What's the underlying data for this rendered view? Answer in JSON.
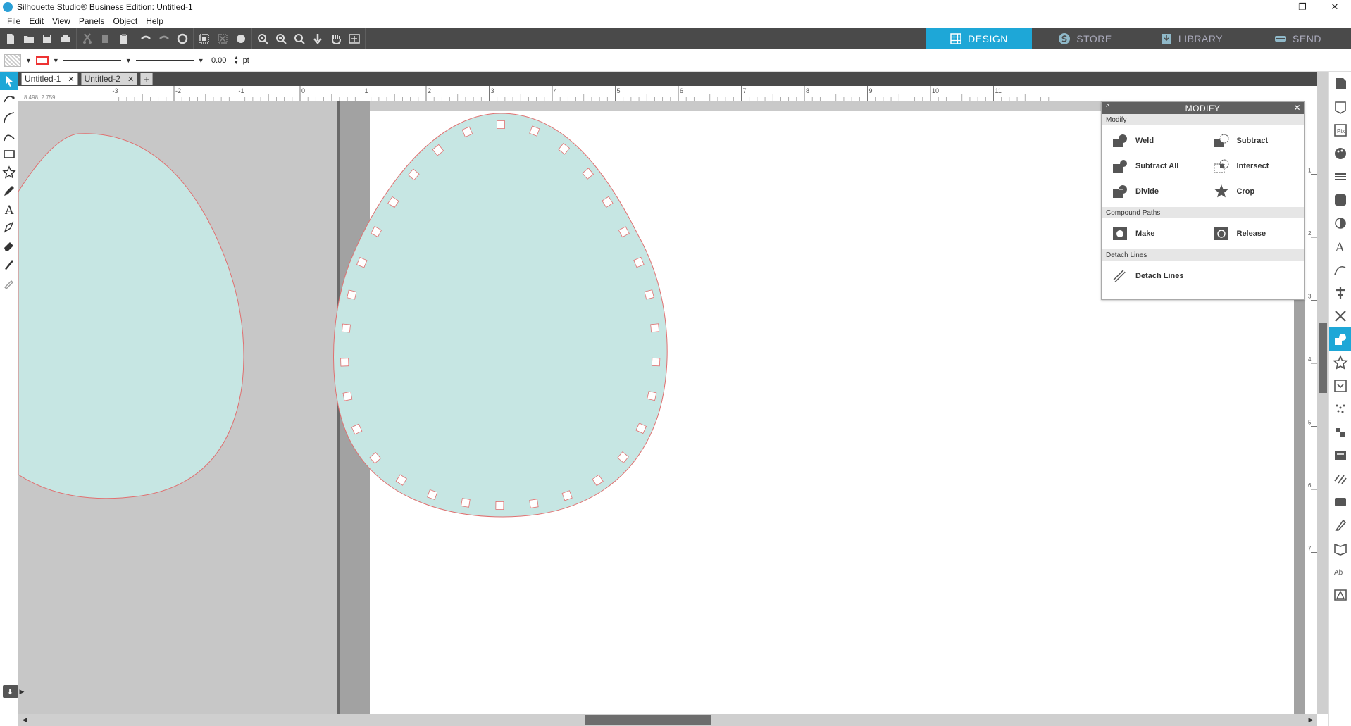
{
  "window": {
    "title": "Silhouette Studio® Business Edition: Untitled-1",
    "minimize": "–",
    "restore": "❐",
    "close": "✕"
  },
  "menu": [
    "File",
    "Edit",
    "View",
    "Panels",
    "Object",
    "Help"
  ],
  "nav_tabs": [
    {
      "label": "DESIGN",
      "icon": "grid-icon",
      "active": true
    },
    {
      "label": "STORE",
      "icon": "silhouette-s-icon",
      "active": false
    },
    {
      "label": "LIBRARY",
      "icon": "download-box-icon",
      "active": false
    },
    {
      "label": "SEND",
      "icon": "cutter-icon",
      "active": false
    }
  ],
  "properties": {
    "line_width": "0.00",
    "unit": "pt"
  },
  "doc_tabs": [
    {
      "label": "Untitled-1",
      "close": "✕",
      "active": true
    },
    {
      "label": "Untitled-2",
      "close": "✕",
      "active": false
    }
  ],
  "add_tab": "+",
  "ruler": {
    "coords": "8.498, 2.759",
    "labels": [
      "-3",
      "-2",
      "-1",
      "0",
      "1",
      "2",
      "3",
      "4",
      "5",
      "6",
      "7",
      "8",
      "9",
      "10",
      "11"
    ],
    "v_labels": [
      "1",
      "2",
      "3",
      "4",
      "5",
      "6",
      "7"
    ]
  },
  "modify_panel": {
    "title": "MODIFY",
    "collapse": "^",
    "close": "✕",
    "sections": {
      "modify": "Modify",
      "compound": "Compound Paths",
      "detach": "Detach Lines"
    },
    "modify_items": [
      "Weld",
      "Subtract",
      "Subtract All",
      "Intersect",
      "Divide",
      "Crop"
    ],
    "compound_items": [
      "Make",
      "Release"
    ],
    "detach_items": [
      "Detach Lines"
    ]
  },
  "colors": {
    "accent": "#1ea7d7",
    "toolbar_bg": "#4a4a4a",
    "shape_fill": "#c6e6e3",
    "shape_stroke": "#e07070"
  }
}
